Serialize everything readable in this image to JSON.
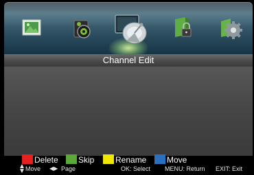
{
  "menu": {
    "items": [
      {
        "icon": "picture-icon"
      },
      {
        "icon": "sound-icon"
      },
      {
        "icon": "channel-icon",
        "selected": true
      },
      {
        "icon": "lock-icon"
      },
      {
        "icon": "setup-icon"
      }
    ]
  },
  "title": "Channel Edit",
  "legend": {
    "delete": {
      "label": "Delete",
      "color": "#e62020"
    },
    "skip": {
      "label": "Skip",
      "color": "#5aa83a"
    },
    "rename": {
      "label": "Rename",
      "color": "#f2e600"
    },
    "move": {
      "label": "Move",
      "color": "#2a6fc0"
    }
  },
  "help": {
    "move_icon": "▲​▼",
    "move": "Move",
    "page_icon": "◀▶",
    "page": "Page",
    "ok": "OK: Select",
    "menu": "MENU: Return",
    "exit": "EXIT: Exit"
  }
}
